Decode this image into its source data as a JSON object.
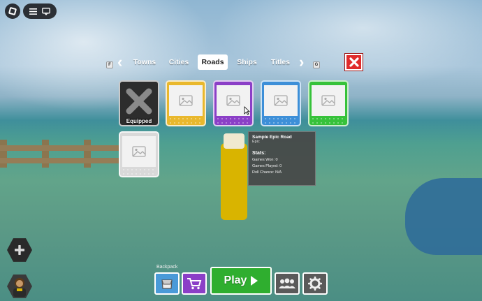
{
  "tabs": {
    "left_key": "F",
    "right_key": "G",
    "items": [
      {
        "label": "Towns"
      },
      {
        "label": "Cities"
      },
      {
        "label": "Roads",
        "active": true
      },
      {
        "label": "Ships"
      },
      {
        "label": "Titles"
      }
    ]
  },
  "cards": [
    {
      "name": "equipped",
      "color": "#2d2d2d",
      "label": "Equipped"
    },
    {
      "name": "legendary",
      "color": "#e9b82d"
    },
    {
      "name": "epic",
      "color": "#8b3fc7"
    },
    {
      "name": "rare",
      "color": "#3d8fd8"
    },
    {
      "name": "uncommon",
      "color": "#36c23a"
    },
    {
      "name": "common",
      "color": "#d9d9d9"
    }
  ],
  "tooltip": {
    "title": "Sample Epic Road",
    "rarity": "Epic",
    "stats_heading": "Stats:",
    "games_won": "Games Won: 0",
    "games_played": "Games Played: 0",
    "roll_chance": "Roll Chance: N/A"
  },
  "bottom_bar": {
    "backpack_label": "Backpack",
    "play_label": "Play"
  },
  "icons": {
    "roblox": "roblox-logo-icon",
    "menu": "hamburger-icon",
    "chat": "chat-icon",
    "close": "close-icon",
    "emote": "add-icon",
    "backpack": "backpack-icon",
    "shop": "cart-icon",
    "players": "group-icon",
    "settings": "gear-icon"
  }
}
